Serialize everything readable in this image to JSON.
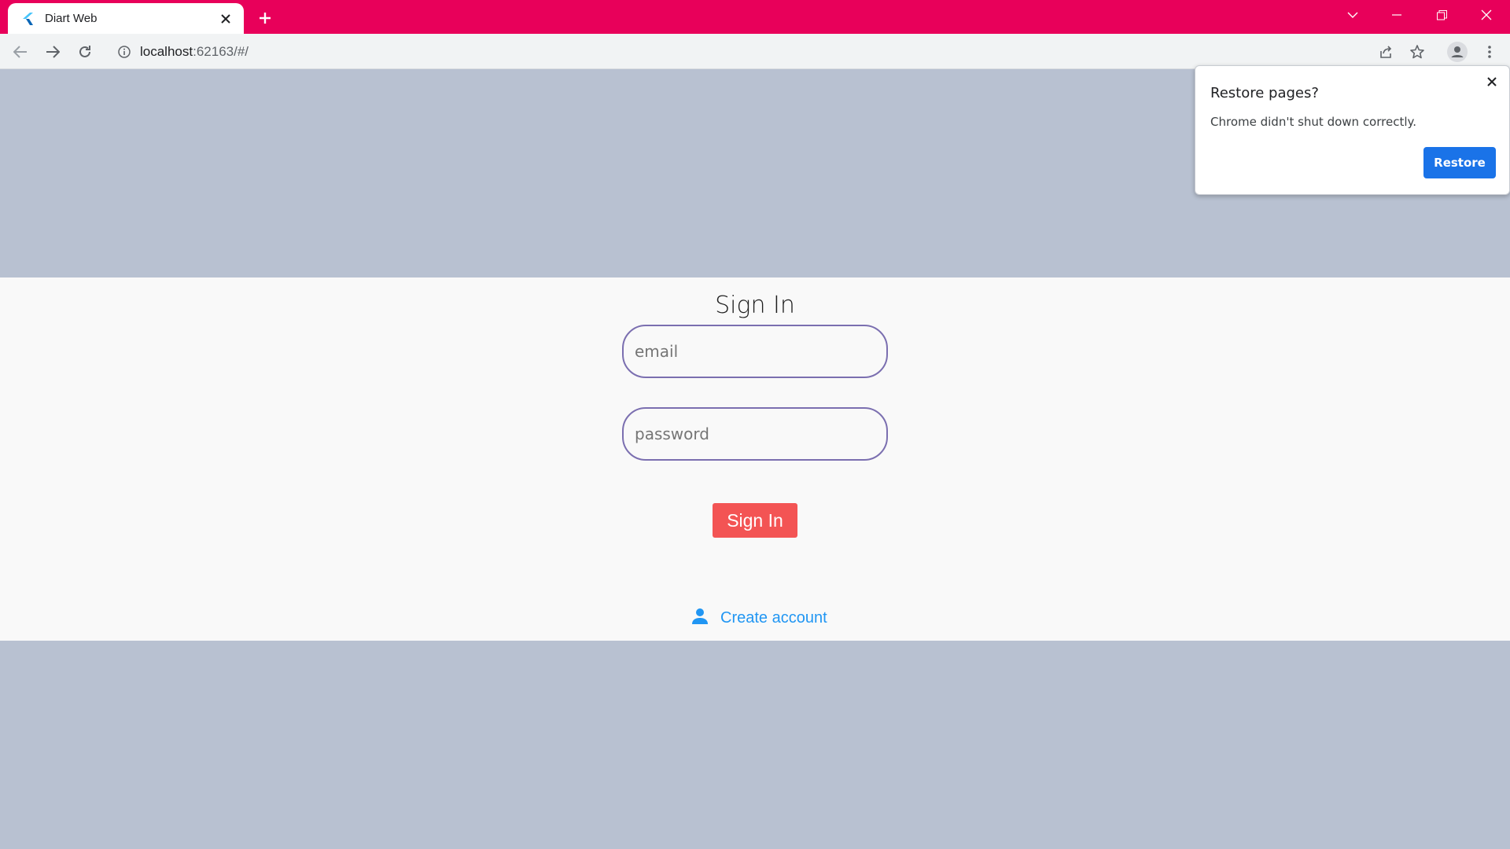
{
  "browser": {
    "tab": {
      "title": "Diart Web",
      "close_icon": "close-icon",
      "favicon": "flutter-icon"
    },
    "new_tab_icon": "plus-icon",
    "window_controls": [
      "chevron-down-icon",
      "minimize-icon",
      "restore-icon",
      "close-icon"
    ],
    "address": {
      "host": "localhost",
      "rest": ":62163/#/"
    },
    "toolbar_icons": [
      "back-icon",
      "forward-icon",
      "reload-icon",
      "share-icon",
      "star-icon",
      "profile-icon",
      "menu-icon"
    ],
    "colors": {
      "tabstrip": "#e8005a",
      "toolbar": "#f1f3f4"
    }
  },
  "page": {
    "title": "Sign In",
    "email": {
      "placeholder": "email",
      "value": ""
    },
    "password": {
      "placeholder": "password",
      "value": ""
    },
    "signin_button": "Sign In",
    "create_account": "Create account",
    "create_account_icon": "person-icon",
    "colors": {
      "background": "#b8c1d1",
      "panel": "#f9f9f9",
      "field_border": "#7b6fb0",
      "button": "#f35454",
      "link": "#2196f3"
    }
  },
  "popup": {
    "title": "Restore pages?",
    "message": "Chrome didn't shut down correctly.",
    "button": "Restore",
    "close_icon": "close-icon",
    "button_color": "#1a73e8"
  }
}
